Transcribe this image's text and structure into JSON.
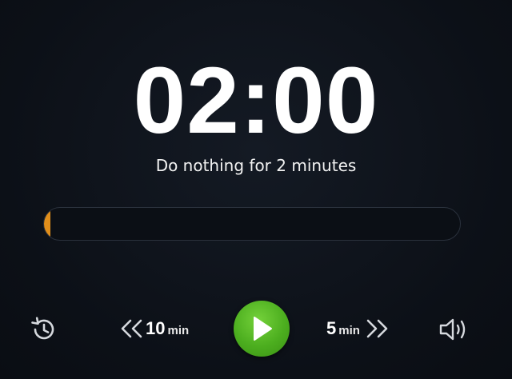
{
  "timer": {
    "display": "02:00"
  },
  "subtitle": "Do nothing for 2 minutes",
  "progress": {
    "fraction": 0.0
  },
  "controls": {
    "rewind": {
      "amount": "10",
      "unit": "min",
      "icon": "double-chevron-left-icon"
    },
    "forward": {
      "amount": "5",
      "unit": "min",
      "icon": "double-chevron-right-icon"
    },
    "play": {
      "icon": "play-icon"
    },
    "history": {
      "icon": "history-icon"
    },
    "volume": {
      "icon": "volume-icon"
    }
  },
  "colors": {
    "background": "#0c1017",
    "progress_fill": "#e08e1b",
    "play_button": "#4cae1f",
    "text": "#ffffff"
  }
}
